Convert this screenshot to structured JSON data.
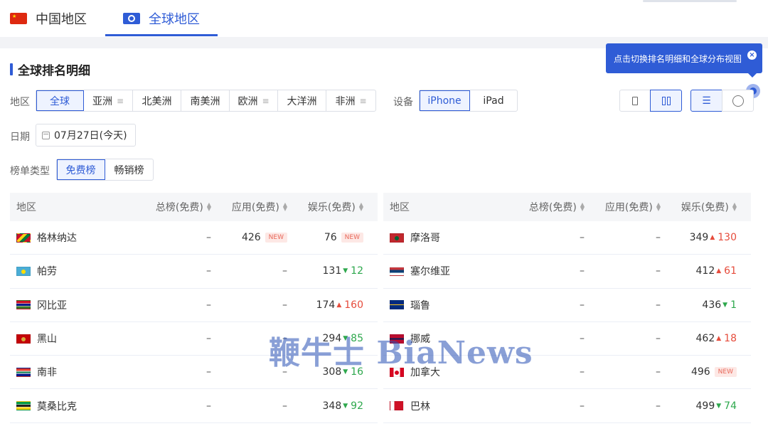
{
  "top_tabs": [
    {
      "label": "中国地区",
      "flag": "china"
    },
    {
      "label": "全球地区",
      "icon": "globe-icon"
    }
  ],
  "section_title": "全球排名明细",
  "tooltip": {
    "text": "点击切换排名明细和全球分布视图",
    "close": "×"
  },
  "filters": {
    "region_label": "地区",
    "regions": [
      "全球",
      "亚洲",
      "北美洲",
      "南美洲",
      "欧洲",
      "大洋洲",
      "非洲"
    ],
    "region_selected": "全球",
    "device_label": "设备",
    "devices": [
      "iPhone",
      "iPad"
    ],
    "device_selected": "iPhone",
    "date_label": "日期",
    "date_value": "07月27日(今天)",
    "chart_type_label": "榜单类型",
    "chart_types": [
      "免费榜",
      "畅销榜"
    ],
    "chart_type_selected": "免费榜"
  },
  "table_headers": [
    "地区",
    "总榜(免费)",
    "应用(免费)",
    "娱乐(免费)"
  ],
  "left_rows": [
    {
      "region": "格林纳达",
      "flag": "grenada",
      "total": "–",
      "app": {
        "rank": "426",
        "badge": "NEW"
      },
      "ent": {
        "rank": "76",
        "badge": "NEW"
      }
    },
    {
      "region": "帕劳",
      "flag": "palau",
      "total": "–",
      "app": {
        "rank": "–"
      },
      "ent": {
        "rank": "131",
        "dir": "down",
        "chg": "12"
      }
    },
    {
      "region": "冈比亚",
      "flag": "gambia",
      "total": "–",
      "app": {
        "rank": "–"
      },
      "ent": {
        "rank": "174",
        "dir": "up",
        "chg": "160"
      }
    },
    {
      "region": "黑山",
      "flag": "montenegro",
      "total": "–",
      "app": {
        "rank": "–"
      },
      "ent": {
        "rank": "294",
        "dir": "down",
        "chg": "85"
      }
    },
    {
      "region": "南非",
      "flag": "south-africa",
      "total": "–",
      "app": {
        "rank": "–"
      },
      "ent": {
        "rank": "308",
        "dir": "down",
        "chg": "16"
      }
    },
    {
      "region": "莫桑比克",
      "flag": "mozambique",
      "total": "–",
      "app": {
        "rank": "–"
      },
      "ent": {
        "rank": "348",
        "dir": "down",
        "chg": "92"
      }
    }
  ],
  "right_rows": [
    {
      "region": "摩洛哥",
      "flag": "morocco",
      "total": "–",
      "app": {
        "rank": "–"
      },
      "ent": {
        "rank": "349",
        "dir": "up",
        "chg": "130"
      }
    },
    {
      "region": "塞尔维亚",
      "flag": "serbia",
      "total": "–",
      "app": {
        "rank": "–"
      },
      "ent": {
        "rank": "412",
        "dir": "up",
        "chg": "61"
      }
    },
    {
      "region": "瑙鲁",
      "flag": "nauru",
      "total": "–",
      "app": {
        "rank": "–"
      },
      "ent": {
        "rank": "436",
        "dir": "down",
        "chg": "1"
      }
    },
    {
      "region": "挪威",
      "flag": "norway",
      "total": "–",
      "app": {
        "rank": "–"
      },
      "ent": {
        "rank": "462",
        "dir": "up",
        "chg": "18"
      }
    },
    {
      "region": "加拿大",
      "flag": "canada",
      "total": "–",
      "app": {
        "rank": "–"
      },
      "ent": {
        "rank": "496",
        "badge": "NEW"
      }
    },
    {
      "region": "巴林",
      "flag": "bahrain",
      "total": "–",
      "app": {
        "rank": "–"
      },
      "ent": {
        "rank": "499",
        "dir": "down",
        "chg": "74"
      }
    }
  ],
  "watermark": "鞭牛士 BiaNews",
  "colors": {
    "accent": "#2f5cd6",
    "up": "#e64c3c",
    "down": "#2ea84d"
  }
}
